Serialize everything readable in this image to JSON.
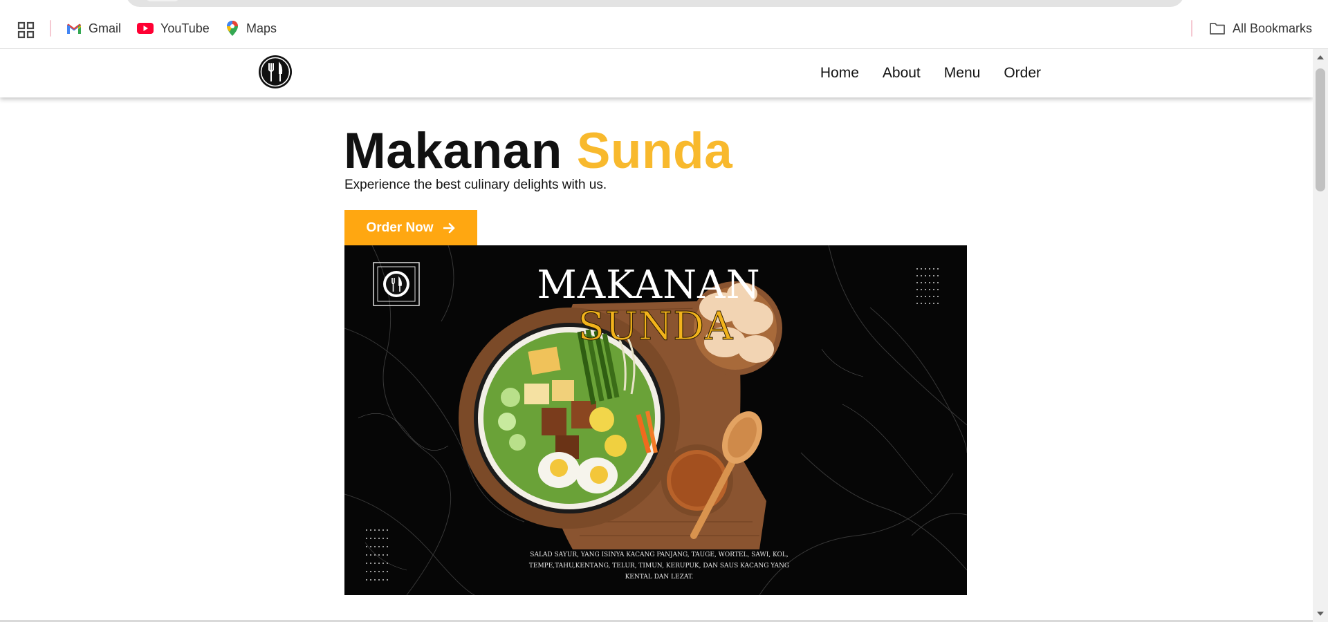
{
  "bookmarks_bar": {
    "apps_icon": "apps-grid-icon",
    "items": [
      {
        "label": "Gmail",
        "icon": "gmail-icon"
      },
      {
        "label": "YouTube",
        "icon": "youtube-icon"
      },
      {
        "label": "Maps",
        "icon": "maps-icon"
      }
    ],
    "all_bookmarks": {
      "label": "All Bookmarks",
      "icon": "folder-icon"
    }
  },
  "site": {
    "logo_icon": "fork-knife-logo-icon",
    "nav": [
      {
        "label": "Home"
      },
      {
        "label": "About"
      },
      {
        "label": "Menu"
      },
      {
        "label": "Order"
      }
    ]
  },
  "hero": {
    "title_main": "Makanan",
    "title_accent": "Sunda",
    "subtitle": "Experience the best culinary delights with us.",
    "cta_label": "Order Now",
    "cta_icon": "arrow-right-icon",
    "image": {
      "poster_title_line1": "MAKANAN",
      "poster_title_line2": "SUNDA",
      "poster_caption": "SALAD SAYUR, YANG ISINYA KACANG PANJANG, TAUGE, WORTEL, SAWI, KOL, TEMPE,TAHU,KENTANG, TELUR, TIMUN, KERUPUK, DAN SAUS KACANG YANG KENTAL DAN LEZAT."
    }
  },
  "colors": {
    "accent": "#f8b92d",
    "button": "#ffa711",
    "text": "#111111"
  }
}
